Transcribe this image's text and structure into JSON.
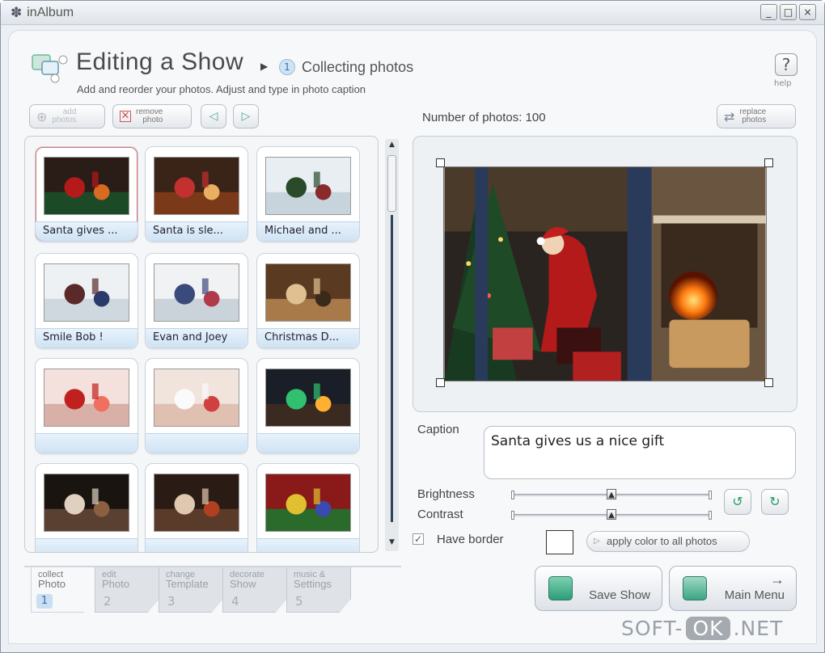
{
  "window": {
    "app_title": "inAlbum",
    "controls": {
      "minimize": "_",
      "maximize": "□",
      "close": "×"
    }
  },
  "header": {
    "title": "Editing a Show",
    "step_number": "1",
    "step_label": "Collecting photos",
    "subtitle": "Add and reorder your photos. Adjust and type in photo caption",
    "help_label": "help",
    "help_symbol": "?"
  },
  "toolbar": {
    "add_line1": "add",
    "add_line2": "photos",
    "remove_line1": "remove",
    "remove_line2": "photo",
    "replace_line1": "replace",
    "replace_line2": "photos",
    "photo_count_text": "Number of photos: 100"
  },
  "photos": [
    {
      "caption": "Santa gives ...",
      "theme": "santa-tree"
    },
    {
      "caption": "Santa is sle...",
      "theme": "santa-sleep"
    },
    {
      "caption": "Michael and ...",
      "theme": "snow-kids"
    },
    {
      "caption": "Smile Bob !",
      "theme": "snow-bob"
    },
    {
      "caption": "Evan and Joey",
      "theme": "snow-two"
    },
    {
      "caption": "Christmas D...",
      "theme": "dinner"
    },
    {
      "caption": "",
      "theme": "ornaments-red"
    },
    {
      "caption": "",
      "theme": "snowman"
    },
    {
      "caption": "",
      "theme": "lights"
    },
    {
      "caption": "",
      "theme": "window"
    },
    {
      "caption": "",
      "theme": "fireplace-kids"
    },
    {
      "caption": "",
      "theme": "gifts"
    }
  ],
  "editor": {
    "caption_label": "Caption",
    "caption_value": "Santa gives us a nice gift",
    "brightness_label": "Brightness",
    "brightness_value": 0.5,
    "contrast_label": "Contrast",
    "contrast_value": 0.5,
    "have_border_label": "Have border",
    "have_border_checked": true,
    "apply_color_label": "apply color to all photos"
  },
  "actions": {
    "save_show": "Save Show",
    "main_menu": "Main Menu"
  },
  "tabs": [
    {
      "line1": "collect",
      "line2": "Photo",
      "number": "1",
      "active": true
    },
    {
      "line1": "edit",
      "line2": "Photo",
      "number": "2",
      "active": false
    },
    {
      "line1": "change",
      "line2": "Template",
      "number": "3",
      "active": false
    },
    {
      "line1": "decorate",
      "line2": "Show",
      "number": "4",
      "active": false
    },
    {
      "line1": "music &",
      "line2": "Settings",
      "number": "5",
      "active": false
    }
  ],
  "watermark": {
    "left": "SOFT-",
    "ok": "OK",
    "right": ".NET"
  }
}
